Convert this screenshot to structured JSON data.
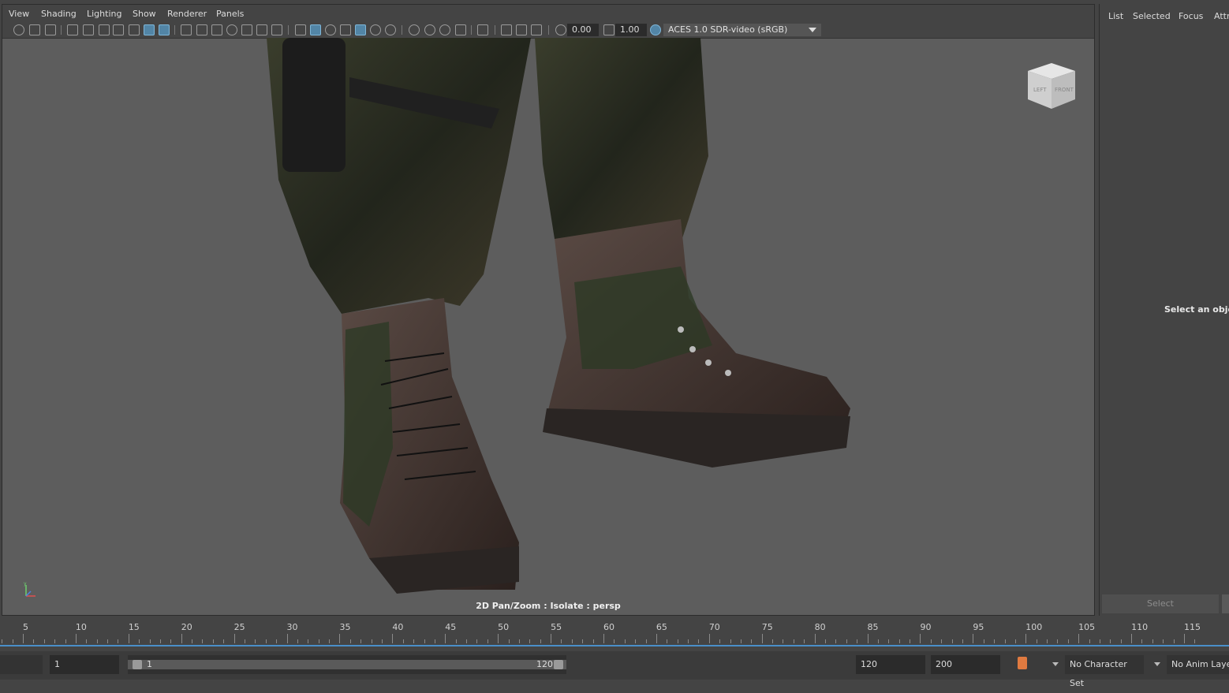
{
  "menubar": {
    "items": [
      "View",
      "Shading",
      "Lighting",
      "Show",
      "Renderer",
      "Panels"
    ]
  },
  "toolbar": {
    "exposure_value": "0.00",
    "gamma_value": "1.00",
    "color_space": "ACES 1.0 SDR-video (sRGB)",
    "icons": [
      "select-camera-icon",
      "camera-attributes-icon",
      "bookmark-icon",
      "grid-icon",
      "film-gate-icon",
      "resolution-gate-icon",
      "wireframe-icon",
      "smooth-shade-icon",
      "textured-icon",
      "lighting-icon",
      "shadows-icon",
      "isolate-icon",
      "xray-icon",
      "exposure-icon",
      "gamma-icon",
      "color-management-icon"
    ]
  },
  "viewport": {
    "hud_label": "2D Pan/Zoom : Isolate : persp",
    "viewcube": {
      "left_face": "LEFT",
      "front_face": "FRONT"
    },
    "axis": {
      "y": "y",
      "x": "x",
      "z": "z"
    }
  },
  "right_panel": {
    "tabs": [
      "List",
      "Selected",
      "Focus",
      "Attr"
    ],
    "empty_message": "Select an object",
    "select_button": "Select"
  },
  "timeline": {
    "ticks": [
      "5",
      "10",
      "15",
      "20",
      "25",
      "30",
      "35",
      "40",
      "45",
      "50",
      "55",
      "60",
      "65",
      "70",
      "75",
      "80",
      "85",
      "90",
      "95",
      "100",
      "105",
      "110",
      "115"
    ]
  },
  "range_bar": {
    "start_frame": "1",
    "range_start": "1",
    "range_end": "120",
    "end_frame": "120",
    "max_frame": "200",
    "character_set": "No Character Set",
    "anim_layer": "No Anim Layer"
  },
  "colors": {
    "viewport_bg": "#5d5d5d",
    "ui_bg": "#444444",
    "accent": "#4a8fc9"
  }
}
